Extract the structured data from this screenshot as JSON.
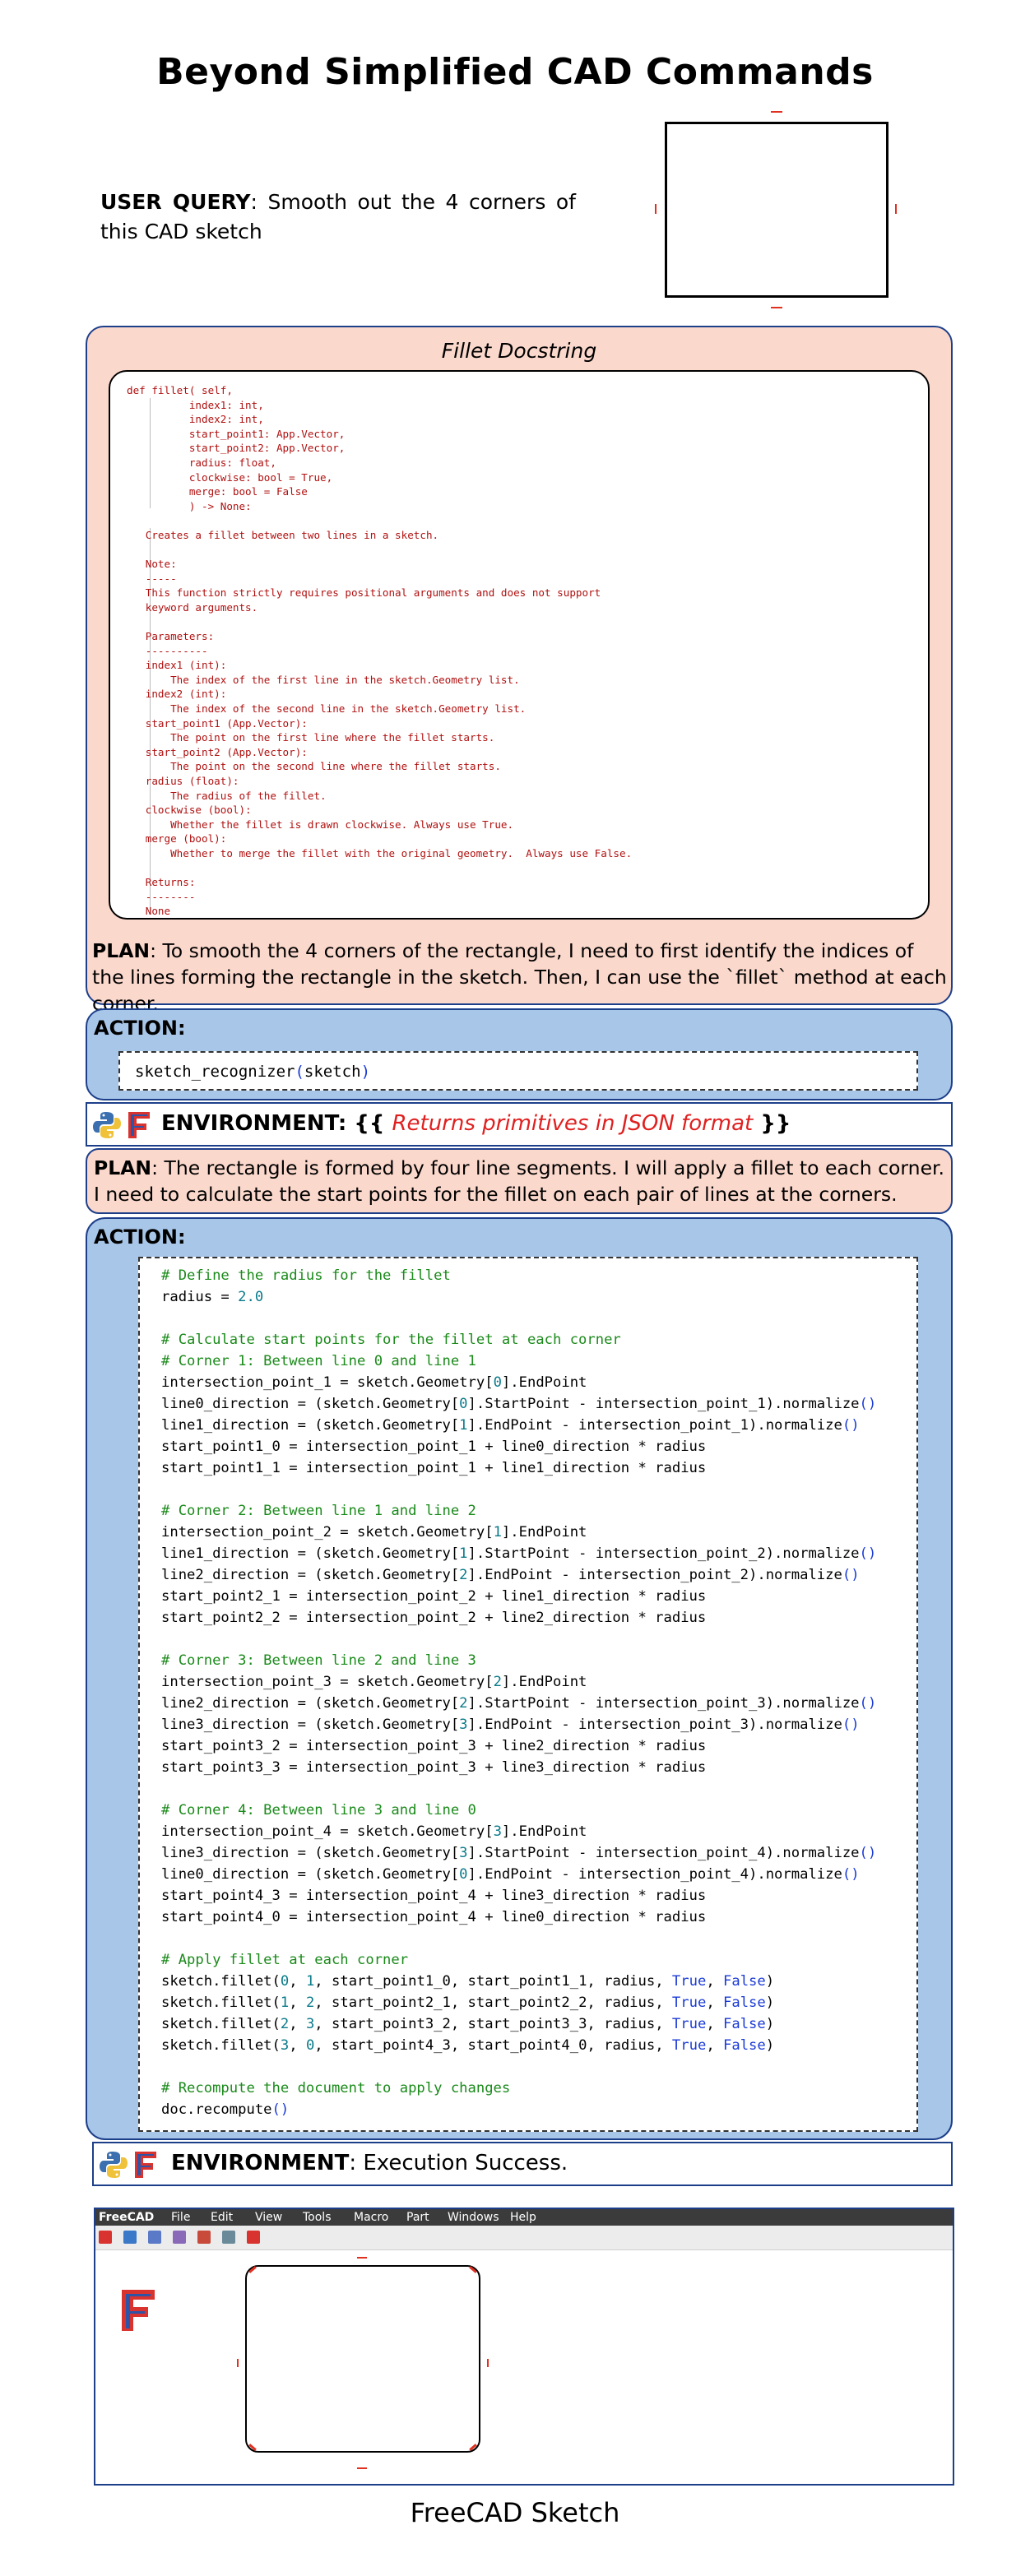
{
  "title": "Beyond Simplified CAD Commands",
  "user_query": {
    "label": "USER QUERY",
    "text": ": Smooth out the 4 corners of this CAD sketch"
  },
  "docstring_panel": {
    "title": "Fillet Docstring",
    "code": "def fillet( self,\n          index1: int,\n          index2: int,\n          start_point1: App.Vector,\n          start_point2: App.Vector,\n          radius: float,\n          clockwise: bool = True,\n          merge: bool = False\n          ) -> None:\n\n   Creates a fillet between two lines in a sketch.\n\n   Note:\n   -----\n   This function strictly requires positional arguments and does not support\n   keyword arguments.\n\n   Parameters:\n   ----------\n   index1 (int):\n       The index of the first line in the sketch.Geometry list.\n   index2 (int):\n       The index of the second line in the sketch.Geometry list.\n   start_point1 (App.Vector):\n       The point on the first line where the fillet starts.\n   start_point2 (App.Vector):\n       The point on the second line where the fillet starts.\n   radius (float):\n       The radius of the fillet.\n   clockwise (bool):\n       Whether the fillet is drawn clockwise. Always use True.\n   merge (bool):\n       Whether to merge the fillet with the original geometry.  Always use False.\n\n   Returns:\n   --------\n   None"
  },
  "plan1": {
    "label": "PLAN",
    "text": ": To smooth the 4 corners of the rectangle, I need to first identify the indices of the lines forming the rectangle in the sketch. Then, I can use the `fillet` method at each corner."
  },
  "action1": {
    "label": "ACTION",
    "code_fn": "sketch_recognizer",
    "code_arg": "sketch"
  },
  "environment1": {
    "label": "ENVIRONMENT",
    "open": ": {{ ",
    "text": "Returns primitives in JSON format",
    "close": " }}"
  },
  "plan2": {
    "label": "PLAN",
    "text": ": The rectangle is formed by four line segments. I will apply a fillet to each corner. I need to calculate the start points for the fillet on each pair of lines at the corners."
  },
  "action2": {
    "label": "ACTION",
    "lines": [
      "# Define the radius for the fillet",
      "radius = 2.0",
      "",
      "# Calculate start points for the fillet at each corner",
      "# Corner 1: Between line 0 and line 1",
      "intersection_point_1 = sketch.Geometry[0].EndPoint",
      "line0_direction = (sketch.Geometry[0].StartPoint - intersection_point_1).normalize()",
      "line1_direction = (sketch.Geometry[1].EndPoint - intersection_point_1).normalize()",
      "start_point1_0 = intersection_point_1 + line0_direction * radius",
      "start_point1_1 = intersection_point_1 + line1_direction * radius",
      "",
      "# Corner 2: Between line 1 and line 2",
      "intersection_point_2 = sketch.Geometry[1].EndPoint",
      "line1_direction = (sketch.Geometry[1].StartPoint - intersection_point_2).normalize()",
      "line2_direction = (sketch.Geometry[2].EndPoint - intersection_point_2).normalize()",
      "start_point2_1 = intersection_point_2 + line1_direction * radius",
      "start_point2_2 = intersection_point_2 + line2_direction * radius",
      "",
      "# Corner 3: Between line 2 and line 3",
      "intersection_point_3 = sketch.Geometry[2].EndPoint",
      "line2_direction = (sketch.Geometry[2].StartPoint - intersection_point_3).normalize()",
      "line3_direction = (sketch.Geometry[3].EndPoint - intersection_point_3).normalize()",
      "start_point3_2 = intersection_point_3 + line2_direction * radius",
      "start_point3_3 = intersection_point_3 + line3_direction * radius",
      "",
      "# Corner 4: Between line 3 and line 0",
      "intersection_point_4 = sketch.Geometry[3].EndPoint",
      "line3_direction = (sketch.Geometry[3].StartPoint - intersection_point_4).normalize()",
      "line0_direction = (sketch.Geometry[0].EndPoint - intersection_point_4).normalize()",
      "start_point4_3 = intersection_point_4 + line3_direction * radius",
      "start_point4_0 = intersection_point_4 + line0_direction * radius",
      "",
      "# Apply fillet at each corner",
      "sketch.fillet(0, 1, start_point1_0, start_point1_1, radius, True, False)",
      "sketch.fillet(1, 2, start_point2_1, start_point2_2, radius, True, False)",
      "sketch.fillet(2, 3, start_point3_2, start_point3_3, radius, True, False)",
      "sketch.fillet(3, 0, start_point4_3, start_point4_0, radius, True, False)",
      "",
      "# Recompute the document to apply changes",
      "doc.recompute()"
    ]
  },
  "environment2": {
    "label": "ENVIRONMENT",
    "text": ": Execution Success."
  },
  "freecad": {
    "menu": [
      "FreeCAD",
      "File",
      "Edit",
      "View",
      "Tools",
      "Macro",
      "Part",
      "Windows",
      "Help"
    ],
    "toolbar_icons": [
      "new-doc-icon",
      "open-doc-icon",
      "part-box-icon",
      "workbench-icon",
      "macro-record-icon",
      "macro-edit-icon",
      "sketch-grid-icon"
    ]
  },
  "caption": "FreeCAD Sketch",
  "colors": {
    "plan_bg": "#fbd8cc",
    "action_bg": "#a8c6e8",
    "panel_border": "#1d3f8a",
    "marker_red": "#e03020",
    "docstring_text": "#b01010",
    "comment_green": "#1a8a1a",
    "keyword_blue": "#1a3ad6"
  }
}
